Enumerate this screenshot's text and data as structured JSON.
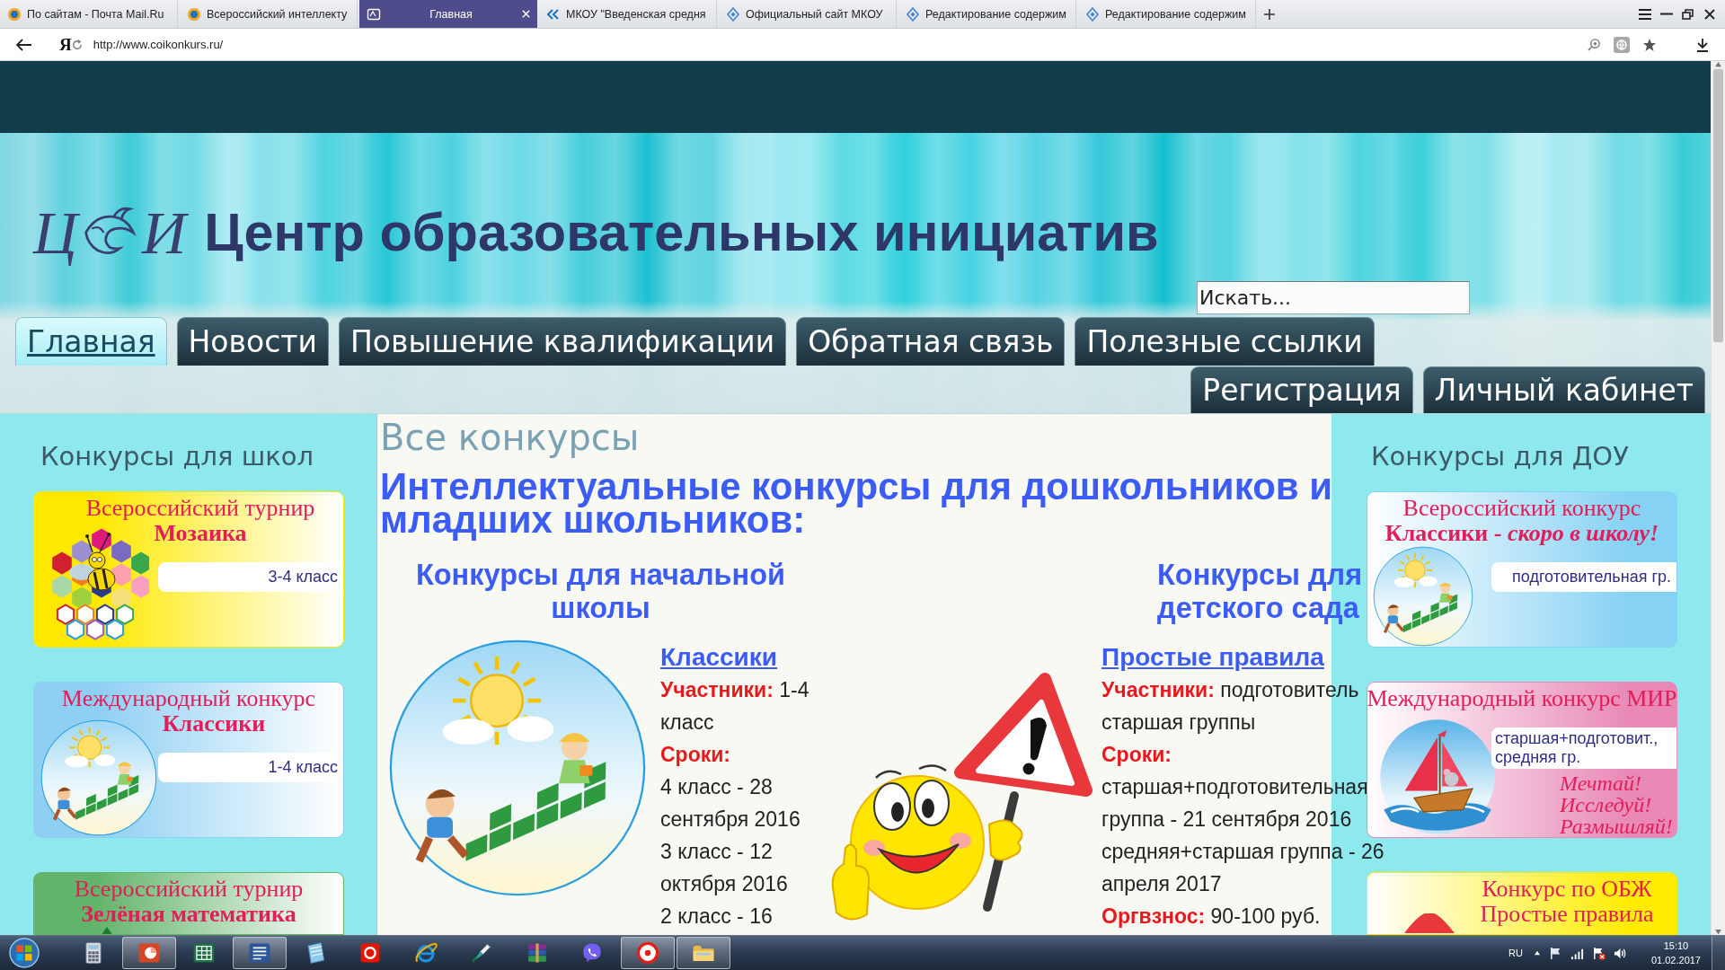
{
  "browser": {
    "tabs": [
      {
        "title": "По сайтам - Почта Mail.Ru",
        "kind": "ring",
        "selected": false
      },
      {
        "title": "Всероссийский интеллекту",
        "kind": "ring",
        "selected": false
      },
      {
        "title": "Главная",
        "kind": "square",
        "selected": true
      },
      {
        "title": "МКОУ \"Введенская средня",
        "kind": "chevron",
        "selected": false
      },
      {
        "title": "Официальный сайт МКОУ",
        "kind": "diamond",
        "selected": false
      },
      {
        "title": "Редактирование содержим",
        "kind": "diamond",
        "selected": false
      },
      {
        "title": "Редактирование содержим",
        "kind": "diamond",
        "selected": false
      }
    ],
    "logo_button": "Я",
    "url": "http://www.coikonkurs.ru/"
  },
  "header": {
    "logo_letters": [
      "Ц",
      "И"
    ],
    "title": "Центр образовательных инициатив",
    "search": {
      "placeholder": "Искать..."
    }
  },
  "nav": [
    [
      {
        "label": "Главная",
        "selected": true
      },
      {
        "label": "Новости",
        "selected": false
      },
      {
        "label": "Повышение квалификации",
        "selected": false
      },
      {
        "label": "Обратная связь",
        "selected": false
      },
      {
        "label": "Полезные ссылки",
        "selected": false
      }
    ],
    [
      {
        "label": "Регистрация",
        "selected": false
      },
      {
        "label": "Личный кабинет",
        "selected": false
      }
    ]
  ],
  "left_sidebar": {
    "title": "Конкурсы для школ",
    "cards": [
      {
        "color": "#ffe800",
        "kind": "mosaic",
        "title_lines": [
          {
            "text": "Всероссийский турнир",
            "bold": false
          },
          {
            "text": "Мозаика",
            "bold": true
          }
        ],
        "badge": "3-4 класс"
      },
      {
        "color": "#8ecff3",
        "kind": "hopscotch",
        "title_lines": [
          {
            "text": "Международный конкурс",
            "bold": false
          },
          {
            "text": "Классики",
            "bold": true
          }
        ],
        "badge": "1-4 класс"
      },
      {
        "color": "#62b46a",
        "kind": "tree",
        "title_lines": [
          {
            "text": "Всероссийский турнир",
            "bold": false
          },
          {
            "text": "Зелёная математика",
            "bold": true
          }
        ]
      }
    ]
  },
  "main": {
    "title": "Все конкурсы",
    "heading": "Интеллектуальные конкурсы для дошкольников и младших школьников:",
    "sections": [
      {
        "heading": "Конкурсы для начальной школы",
        "kind": "hopscotch",
        "link": "Классики",
        "lines": [
          {
            "kind": "field",
            "label": "Участники:",
            "value": "1-4 класс"
          },
          {
            "kind": "label",
            "text": "Сроки:"
          },
          {
            "kind": "text",
            "text": "4 класс - 28 сентября 2016"
          },
          {
            "kind": "text",
            "text": "3 класс - 12 октября 2016"
          },
          {
            "kind": "text",
            "text": "2 класс - 16"
          }
        ]
      },
      {
        "heading": "Конкурсы для детского сада",
        "kind": "smiley_sign",
        "link": "Простые правила",
        "lines": [
          {
            "kind": "field",
            "label": "Участники:",
            "value": "подготовитель"
          },
          {
            "kind": "text",
            "text": "старшая группы"
          },
          {
            "kind": "label",
            "text": "Сроки:"
          },
          {
            "kind": "text",
            "text": "старшая+подготовительная группа - 21 сентября 2016"
          },
          {
            "kind": "text",
            "text": "средняя+старшая группа - 26 апреля 2017"
          },
          {
            "kind": "field",
            "label": "Оргвзнос:",
            "value": "90-100 руб."
          }
        ]
      }
    ]
  },
  "right_sidebar": {
    "title": "Конкурсы для ДОУ",
    "cards": [
      {
        "color": "#86d2f4",
        "kind": "hopscotch",
        "title_lines": [
          {
            "text": "Всероссийский конкурс",
            "bold": false
          },
          {
            "text": "Классики - *скоро в школу!*",
            "bold": true
          }
        ],
        "badge": "подготовительная гр."
      },
      {
        "color": "#e889b6",
        "kind": "ship",
        "title_lines": [
          {
            "text": "Международный конкурс МИР",
            "bold": false
          }
        ],
        "badge": "старшая+подготовит., средняя гр.",
        "slogans": [
          "Мечтай!",
          "Исследуй!",
          "Размышляй!"
        ]
      },
      {
        "color": "#ffec00",
        "kind": "sign",
        "title_lines": [
          {
            "text": "Конкурс по ОБЖ",
            "bold": false
          },
          {
            "text": "Простые правила",
            "bold": false
          }
        ]
      }
    ]
  },
  "taskbar": {
    "apps": [
      {
        "kind": "calculator",
        "open": false
      },
      {
        "kind": "presentation",
        "open": true
      },
      {
        "kind": "spreadsheet",
        "open": false
      },
      {
        "kind": "document",
        "open": true
      },
      {
        "kind": "notebook",
        "open": false
      },
      {
        "kind": "tile",
        "open": false
      },
      {
        "kind": "globe",
        "open": false
      },
      {
        "kind": "brush",
        "open": false
      },
      {
        "kind": "books",
        "open": false
      },
      {
        "kind": "messenger",
        "open": false
      },
      {
        "kind": "ring",
        "open": true
      },
      {
        "kind": "folder",
        "open": true
      }
    ],
    "language": "RU",
    "time": "15:10",
    "date": "01.02.2017"
  }
}
